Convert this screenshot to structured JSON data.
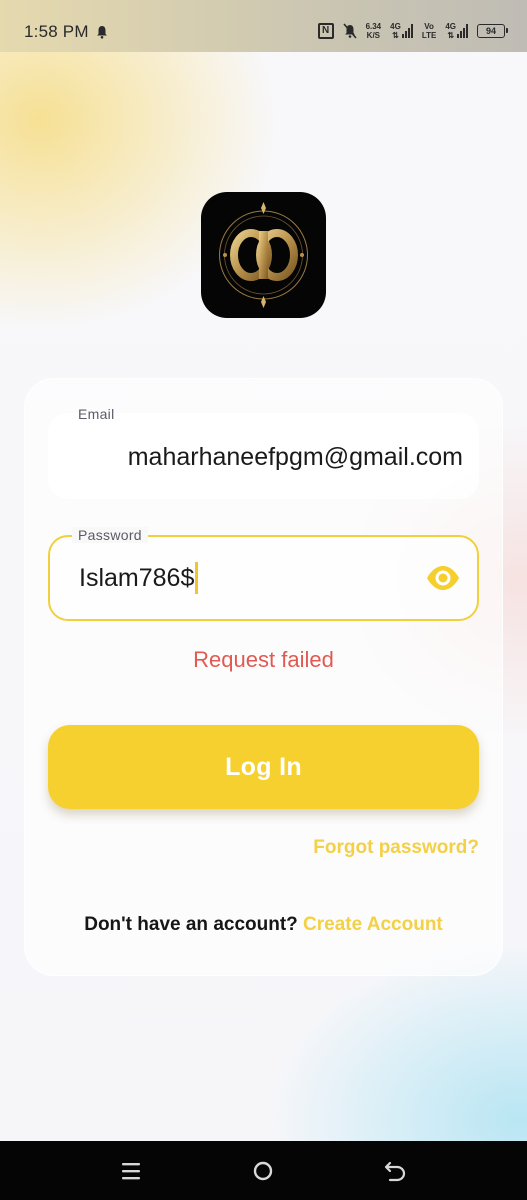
{
  "status_bar": {
    "time": "1:58 PM",
    "speed_value": "6.34",
    "speed_unit": "K/S",
    "net1": "4G",
    "volte_top": "Vo",
    "volte_bottom": "LTE",
    "net2": "4G",
    "battery": "94",
    "icons": [
      "bell-icon",
      "nfc-icon",
      "mute-icon",
      "signal-icon",
      "battery-icon"
    ]
  },
  "login_form": {
    "email_label": "Email",
    "email_value": "maharhaneefpgm@gmail.com",
    "password_label": "Password",
    "password_value": "Islam786$",
    "error_message": "Request failed",
    "login_label": "Log In",
    "forgot_password": "Forgot password?",
    "signup_prompt": "Don't have an account?",
    "create_account": "Create Account"
  },
  "colors": {
    "accent": "#f6d02f",
    "link": "#f3d046",
    "error": "#e05a52",
    "logo_background": "#050505",
    "logo_gold": "#c9a45a"
  },
  "nav_bar": {
    "icons": [
      "menu-icon",
      "home-icon",
      "back-icon"
    ]
  }
}
